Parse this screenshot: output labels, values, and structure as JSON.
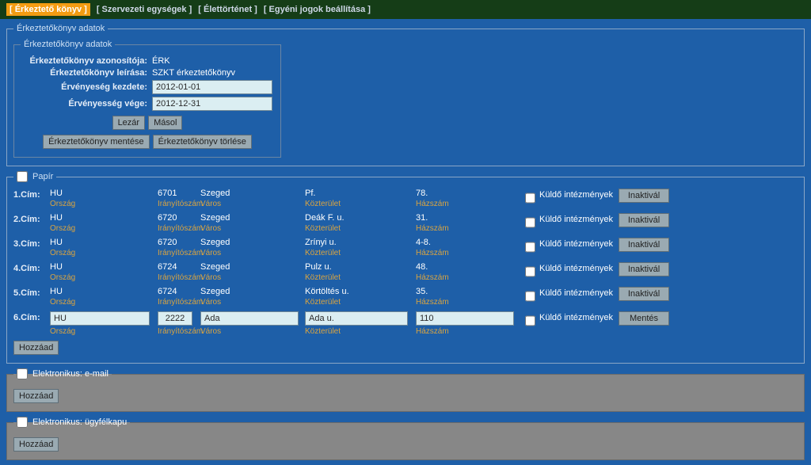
{
  "nav": {
    "items": [
      {
        "label": "[ Érkeztető könyv ]",
        "active": true
      },
      {
        "label": "[  Szervezeti egységek ]",
        "active": false
      },
      {
        "label": "[  Élettörténet ]",
        "active": false
      },
      {
        "label": "[  Egyéni jogok beállítása ]",
        "active": false
      }
    ]
  },
  "book": {
    "outer_legend": "Érkeztetőkönyv adatok",
    "inner_legend": "Érkeztetőkönyv adatok",
    "rows": {
      "id_label": "Érkeztetőkönyv azonosítója:",
      "id_value": "ÉRK",
      "desc_label": "Érkeztetőkönyv leírása:",
      "desc_value": "SZKT érkeztetőkönyv",
      "start_label": "Érvényeség kezdete:",
      "start_value": "2012-01-01",
      "end_label": "Érvényesség vége:",
      "end_value": "2012-12-31"
    },
    "buttons": {
      "close": "Lezár",
      "copy": "Másol",
      "save": "Érkeztetőkönyv mentése",
      "delete": "Érkeztetőkönyv törlése"
    }
  },
  "paper": {
    "legend": "Papír",
    "hints": {
      "orszag": "Ország",
      "irsz": "Irányítószám",
      "varos": "Város",
      "kozt": "Közterület",
      "hazsz": "Házszám"
    },
    "kuldo": "Küldő intézmények",
    "btn_inakt": "Inaktivál",
    "btn_ment": "Mentés",
    "btn_add": "Hozzáad",
    "rows": [
      {
        "label": "1.Cím:",
        "orszag": "HU",
        "irsz": "6701",
        "varos": "Szeged",
        "kozt": "Pf.",
        "hazsz": "78.",
        "editable": false
      },
      {
        "label": "2.Cím:",
        "orszag": "HU",
        "irsz": "6720",
        "varos": "Szeged",
        "kozt": "Deák F. u.",
        "hazsz": "31.",
        "editable": false
      },
      {
        "label": "3.Cím:",
        "orszag": "HU",
        "irsz": "6720",
        "varos": "Szeged",
        "kozt": "Zrínyi u.",
        "hazsz": "4-8.",
        "editable": false
      },
      {
        "label": "4.Cím:",
        "orszag": "HU",
        "irsz": "6724",
        "varos": "Szeged",
        "kozt": "Pulz u.",
        "hazsz": "48.",
        "editable": false
      },
      {
        "label": "5.Cím:",
        "orszag": "HU",
        "irsz": "6724",
        "varos": "Szeged",
        "kozt": "Körtöltés u.",
        "hazsz": "35.",
        "editable": false
      },
      {
        "label": "6.Cím:",
        "orszag": "HU",
        "irsz": "2222",
        "varos": "Ada",
        "kozt": "Ada u.",
        "hazsz": "110",
        "editable": true
      }
    ]
  },
  "email": {
    "legend": "Elektronikus: e-mail",
    "btn_add": "Hozzáad"
  },
  "ugyfelkapu": {
    "legend": "Elektronikus: ügyfélkapu",
    "btn_add": "Hozzáad"
  }
}
